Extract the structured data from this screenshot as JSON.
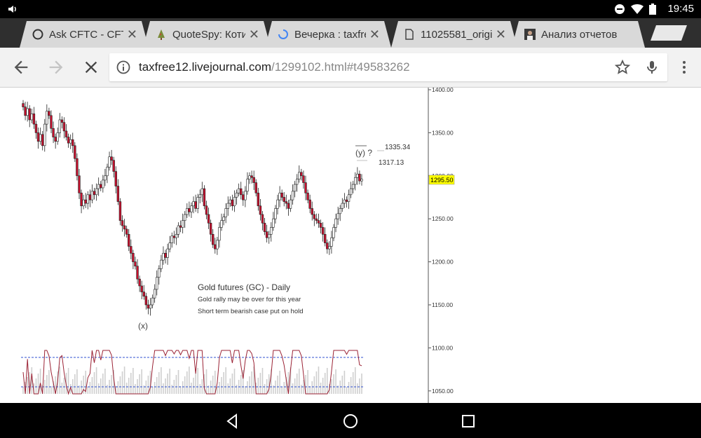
{
  "status_bar": {
    "time": "19:45",
    "icons": [
      "volume-icon",
      "dnd-icon",
      "wifi-icon",
      "battery-icon"
    ]
  },
  "tabs": [
    {
      "title": "Ask CFTC - CFTC",
      "favicon": "cftc-icon",
      "active": false
    },
    {
      "title": "QuoteSpy: Котир",
      "favicon": "tree-icon",
      "active": false
    },
    {
      "title": "Вечерка : taxfree",
      "favicon": "loading-spinner-icon",
      "active": true
    },
    {
      "title": "11025581_origi",
      "favicon": "document-icon",
      "active": false
    },
    {
      "title": "Анализ отчетов",
      "favicon": "portrait-icon",
      "active": false
    }
  ],
  "toolbar": {
    "url_host": "taxfree12.livejournal.com",
    "url_path": "/1299102.html#t49583262"
  },
  "chart": {
    "caption_title": "Gold futures (GC) - Daily",
    "caption_line1": "Gold rally may be over for this year",
    "caption_line2": "Short term bearish case put on hold",
    "wave_x": "(x)",
    "wave_y": "(y) ?",
    "level_high": "1335.34",
    "level_mid": "1317.13",
    "last_price": "1295.50",
    "price_ticks": [
      "1400.00",
      "1350.00",
      "1300.00",
      "1250.00",
      "1200.00",
      "1150.00",
      "1100.00",
      "1050.00"
    ]
  },
  "chart_data": {
    "type": "candlestick",
    "title": "Gold futures (GC) - Daily",
    "y_ticks": [
      1050,
      1100,
      1150,
      1200,
      1250,
      1300,
      1350,
      1400
    ],
    "ylim": [
      1040,
      1405
    ],
    "annotations": [
      {
        "text": "(x)",
        "price": 1140
      },
      {
        "text": "(y) ?",
        "price": 1340
      },
      {
        "text": "1335.34",
        "price": 1335.34
      },
      {
        "text": "1317.13",
        "price": 1317.13
      },
      {
        "text": "1295.50",
        "price": 1295.5
      }
    ],
    "closes": [
      1380,
      1370,
      1378,
      1365,
      1372,
      1360,
      1350,
      1340,
      1348,
      1335,
      1360,
      1375,
      1370,
      1355,
      1345,
      1340,
      1350,
      1365,
      1362,
      1352,
      1345,
      1338,
      1342,
      1335,
      1320,
      1300,
      1280,
      1265,
      1272,
      1268,
      1278,
      1272,
      1282,
      1278,
      1285,
      1290,
      1286,
      1295,
      1300,
      1310,
      1322,
      1318,
      1305,
      1288,
      1270,
      1248,
      1242,
      1238,
      1232,
      1218,
      1210,
      1200,
      1195,
      1180,
      1172,
      1165,
      1160,
      1150,
      1146,
      1150,
      1158,
      1168,
      1182,
      1192,
      1202,
      1210,
      1205,
      1215,
      1222,
      1230,
      1228,
      1232,
      1242,
      1240,
      1248,
      1255,
      1262,
      1258,
      1265,
      1270,
      1262,
      1275,
      1278,
      1285,
      1265,
      1255,
      1245,
      1232,
      1220,
      1215,
      1225,
      1240,
      1248,
      1252,
      1262,
      1268,
      1272,
      1265,
      1275,
      1280,
      1285,
      1278,
      1272,
      1282,
      1296,
      1300,
      1298,
      1292,
      1280,
      1265,
      1255,
      1245,
      1235,
      1228,
      1232,
      1240,
      1250,
      1262,
      1272,
      1280,
      1275,
      1270,
      1268,
      1262,
      1272,
      1282,
      1290,
      1296,
      1304,
      1300,
      1292,
      1280,
      1272,
      1262,
      1255,
      1250,
      1248,
      1245,
      1240,
      1232,
      1222,
      1215,
      1218,
      1228,
      1240,
      1250,
      1256,
      1262,
      1268,
      1272,
      1270,
      1278,
      1285,
      1290,
      1298,
      1302,
      1294,
      1296
    ],
    "stochastic": {
      "upper_band": 80,
      "lower_band": 20
    }
  }
}
